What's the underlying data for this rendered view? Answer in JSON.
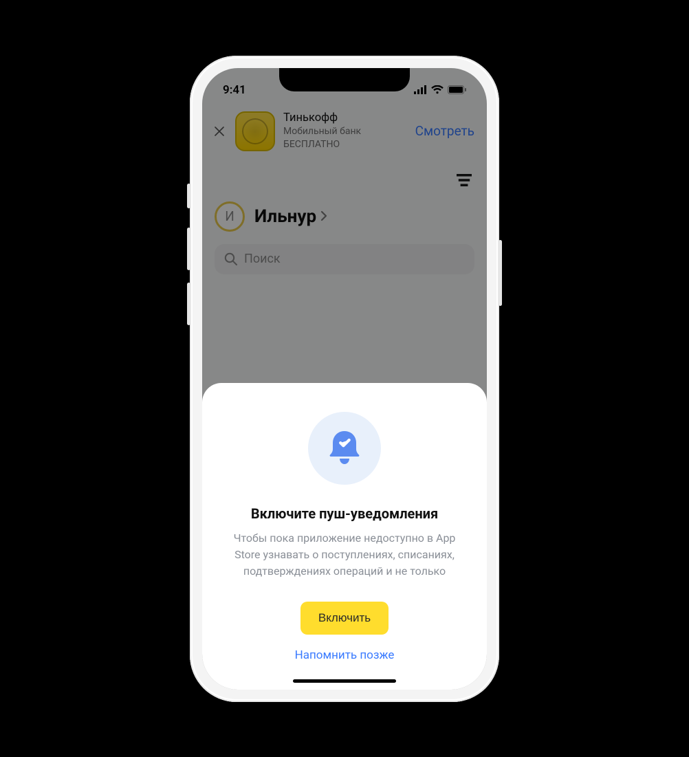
{
  "status_bar": {
    "time": "9:41"
  },
  "smart_banner": {
    "title": "Тинькофф",
    "line1": "Мобильный банк",
    "line2": "БЕСПЛАТНО",
    "cta": "Смотреть"
  },
  "header": {
    "avatar_letter": "И",
    "username": "Ильнур"
  },
  "search": {
    "placeholder": "Поиск"
  },
  "sheet": {
    "title": "Включите пуш-уведомления",
    "body": "Чтобы пока приложение недоступно в App Store узнавать о поступлениях, списаниях, подтверждениях операций и не только",
    "primary": "Включить",
    "secondary": "Напомнить позже"
  },
  "colors": {
    "accent_blue": "#3a7bff",
    "accent_yellow": "#ffdd2d"
  }
}
